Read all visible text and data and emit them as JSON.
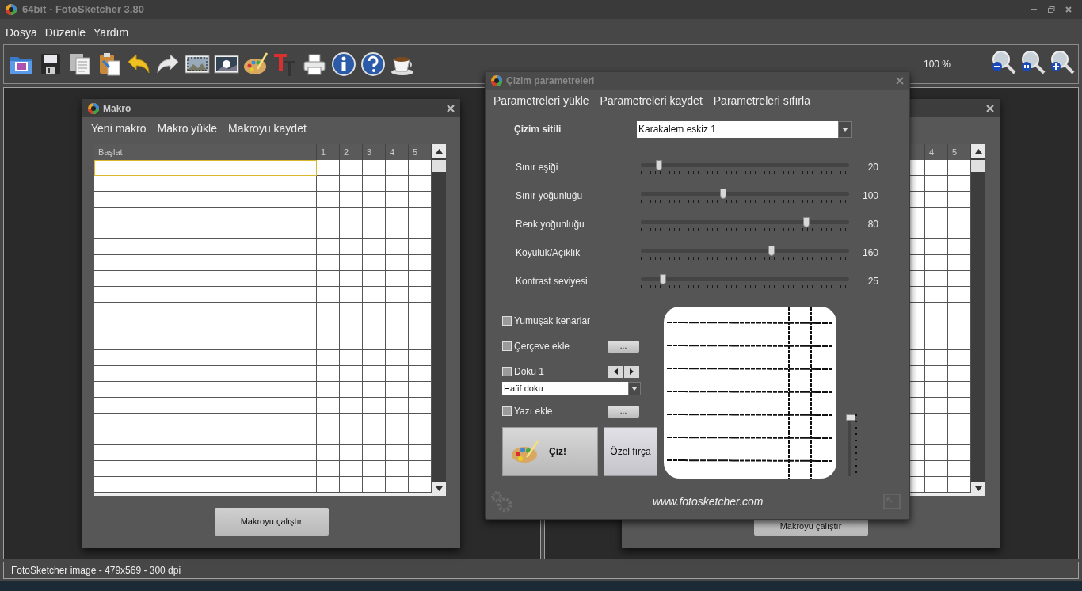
{
  "window": {
    "title": "64bit - FotoSketcher 3.80"
  },
  "menu": [
    "Dosya",
    "Düzenle",
    "Yardım"
  ],
  "toolbar": {
    "zoom": "100 %"
  },
  "macro_windows": [
    {
      "title": "Makro",
      "menu": [
        "Yeni makro",
        "Makro yükle",
        "Makroyu kaydet"
      ],
      "columns": [
        "Başlat",
        "1",
        "2",
        "3",
        "4",
        "5"
      ],
      "run_button": "Makroyu çalıştır",
      "rows": [
        {
          "selected": true
        },
        {
          "selected": false
        },
        {
          "selected": false
        },
        {
          "selected": false
        },
        {
          "selected": false
        },
        {
          "selected": false
        },
        {
          "selected": false
        },
        {
          "selected": false
        },
        {
          "selected": false
        },
        {
          "selected": false
        },
        {
          "selected": false
        },
        {
          "selected": false
        },
        {
          "selected": false
        },
        {
          "selected": false
        },
        {
          "selected": false
        },
        {
          "selected": false
        },
        {
          "selected": false
        },
        {
          "selected": false
        },
        {
          "selected": false
        },
        {
          "selected": false
        },
        {
          "selected": false
        }
      ]
    },
    {
      "columns": [
        "4",
        "5"
      ],
      "run_button": "Makroyu çalıştır",
      "rows": [
        {
          "selected": false
        },
        {
          "selected": false
        },
        {
          "selected": false
        },
        {
          "selected": false
        },
        {
          "selected": false
        },
        {
          "selected": false
        },
        {
          "selected": false
        },
        {
          "selected": false
        },
        {
          "selected": false
        },
        {
          "selected": false
        },
        {
          "selected": false
        },
        {
          "selected": false
        },
        {
          "selected": false
        },
        {
          "selected": false
        },
        {
          "selected": false
        },
        {
          "selected": false
        },
        {
          "selected": false
        },
        {
          "selected": false
        },
        {
          "selected": false
        },
        {
          "selected": false
        },
        {
          "selected": false
        }
      ]
    }
  ],
  "drawing_dialog": {
    "title": "Çizim parametreleri",
    "menu": [
      "Parametreleri yükle",
      "Parametreleri kaydet",
      "Parametreleri sıfırla"
    ],
    "style_label": "Çizim sitili",
    "style_value": "Karakalem eskiz 1",
    "sliders": [
      {
        "label": "Sınır eşiği",
        "value": "20",
        "level": 0.087
      },
      {
        "label": "Sınır yoğunluğu",
        "value": "100",
        "level": 0.395
      },
      {
        "label": "Renk yoğunluğu",
        "value": "80",
        "level": 0.795
      },
      {
        "label": "Koyuluk/Açıklık",
        "value": "160",
        "level": 0.627
      },
      {
        "label": "Kontrast seviyesi",
        "value": "25",
        "level": 0.106
      }
    ],
    "options": [
      {
        "kind": "checkbox",
        "label": "Yumuşak kenarlar",
        "checked": false
      },
      {
        "kind": "checkbox_more",
        "label": "Çerçeve ekle",
        "checked": false,
        "button": "..."
      },
      {
        "kind": "texture",
        "label": "Doku 1",
        "checked": false,
        "texture": "Hafif doku"
      },
      {
        "kind": "checkbox_more",
        "label": "Yazı ekle",
        "checked": false,
        "button": "..."
      }
    ],
    "draw_button": "Çiz!",
    "custom_brush_button": "Özel fırça",
    "preview_zoom": {
      "level": 1
    },
    "website": "www.fotosketcher.com"
  },
  "status_bar": "FotoSketcher image - 479x569 - 300 dpi"
}
